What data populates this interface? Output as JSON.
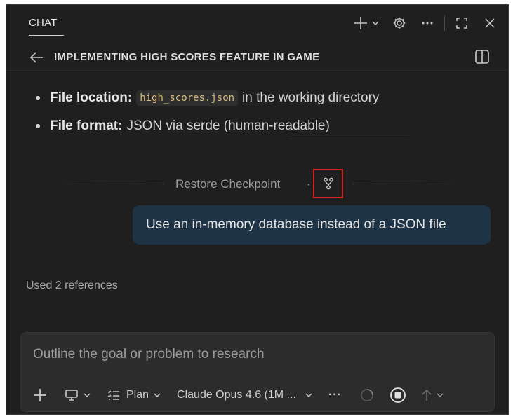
{
  "tabbar": {
    "tab_label": "CHAT"
  },
  "header": {
    "title": "IMPLEMENTING HIGH SCORES FEATURE IN GAME"
  },
  "response": {
    "bullets": [
      {
        "label": "File location:",
        "code": "high_scores.json",
        "text": "in the working directory"
      },
      {
        "label": "File format:",
        "text": "JSON via serde (human-readable)"
      }
    ]
  },
  "checkpoint": {
    "label": "Restore Checkpoint",
    "separator": "·"
  },
  "user_message": {
    "text": "Use an in-memory database instead of a JSON file"
  },
  "references": {
    "text": "Used 2 references"
  },
  "composer": {
    "placeholder": "Outline the goal or problem to research",
    "mode_label": "Plan",
    "model_label": "Claude Opus 4.6 (1M ...",
    "more_label": "···"
  },
  "colors": {
    "background": "#1f1f1f",
    "user_bubble": "#1e3346",
    "highlight_box": "#d02020",
    "code_text": "#d7ba7d"
  },
  "icons": [
    "plus-icon",
    "chevron-down-icon",
    "gear-icon",
    "more-icon",
    "maximize-icon",
    "close-icon",
    "arrow-left-icon",
    "layout-icon",
    "fork-icon",
    "monitor-icon",
    "checklist-icon",
    "spinner-icon",
    "stop-icon",
    "arrow-up-icon"
  ]
}
